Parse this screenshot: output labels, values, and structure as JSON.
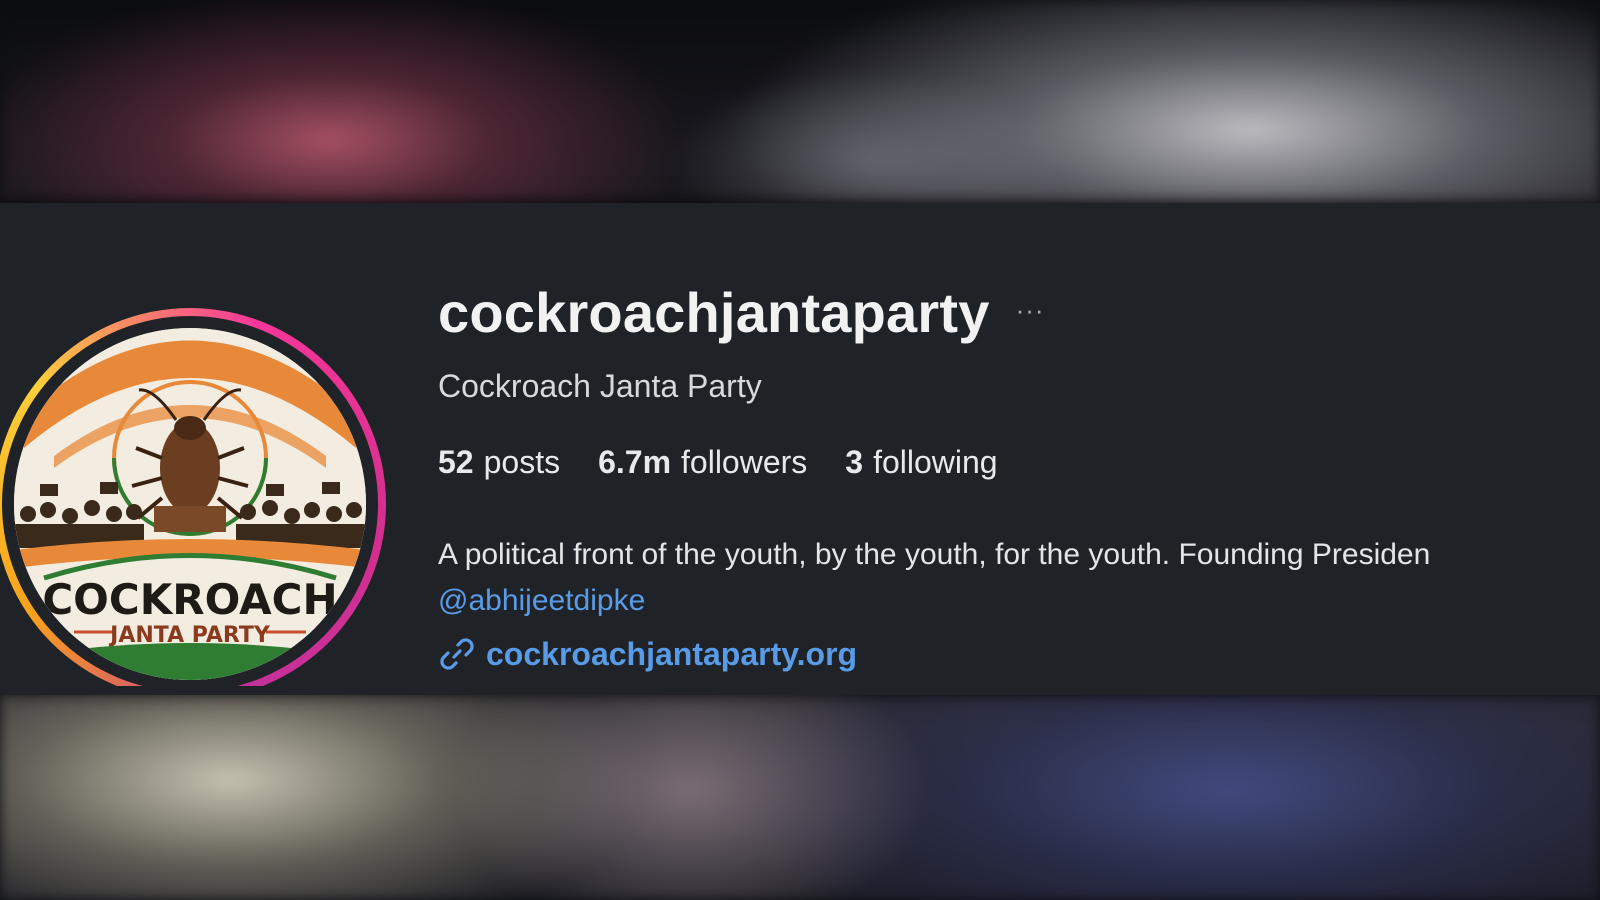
{
  "profile": {
    "username": "cockroachjantaparty",
    "display_name": "Cockroach Janta Party",
    "more_icon": "···",
    "stats": [
      {
        "count": "52",
        "label": "posts"
      },
      {
        "count": "6.7m",
        "label": "followers"
      },
      {
        "count": "3",
        "label": "following"
      }
    ],
    "bio": "A political front of the youth, by the youth, for the youth. Founding Presiden",
    "mention": "@abhijeetdipke",
    "website": "cockroachjantaparty.org",
    "avatar": {
      "logo_text_main": "COCKROACH",
      "logo_text_sub": "JANTA PARTY"
    }
  },
  "icons": {
    "more": "ellipsis-icon",
    "link": "link-icon"
  },
  "colors": {
    "card_background": "#1f2327",
    "link_blue": "#5a9be8",
    "story_ring_start": "#f7379a",
    "story_ring_end": "#fbcf3a",
    "saffron": "#e8893a",
    "green": "#2f7d32"
  }
}
